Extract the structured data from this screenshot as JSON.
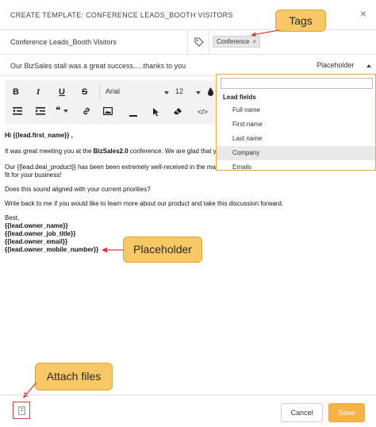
{
  "header": {
    "title": "CREATE TEMPLATE: CONFERENCE LEADS_BOOTH VISITORS",
    "close_glyph": "×"
  },
  "template_name": "Conference Leads_Booth Visitors",
  "tag": {
    "label": "Conference",
    "remove_glyph": "×"
  },
  "subject": "Our BizSales stall was a great success.....thanks to you",
  "placeholder_select": {
    "label": "Placeholder"
  },
  "toolbar": {
    "bold": "B",
    "italic": "I",
    "underline": "U",
    "strike": "S",
    "font": "Arial",
    "size": "12",
    "quote": "❝"
  },
  "body": {
    "greeting_prefix": "Hi ",
    "greeting_var": "{{lead.first_name}}",
    "greeting_suffix": " ,",
    "line1_prefix": "It was great meeting you at the ",
    "line1_bold": "BizSales2.0",
    "line1_suffix": " conference. We are glad that y",
    "line2a": "Our {{lead.deal_product}} has been been extremely well-received in the ma",
    "line2b": "fit for your business!",
    "line3": "Does this sound aligned with your current priorities?",
    "line4": "Write back to me if you would like to learn more about our product and take this discussion forward.",
    "sign_off": "Best,",
    "sig1": "{{lead.owner_name}}",
    "sig2": "{{lead.owner_job_title}}",
    "sig3": "{{lead.owner_email}}",
    "sig4": "{{lead.owner_mobile_number}}"
  },
  "dropdown": {
    "group_label": "Lead fields",
    "options": [
      "Full name",
      "First name",
      "Last name",
      "Company",
      "Emails"
    ],
    "selected": "Company"
  },
  "callouts": {
    "tags": "Tags",
    "placeholder": "Placeholder",
    "attach": "Attach files"
  },
  "footer": {
    "cancel_label": "Cancel",
    "save_label": "Save"
  },
  "colors": {
    "accent": "#f7b24a",
    "callout_bg": "#f8c766",
    "arrow": "#e03b3b",
    "dropdown_border": "#f0a93a"
  }
}
